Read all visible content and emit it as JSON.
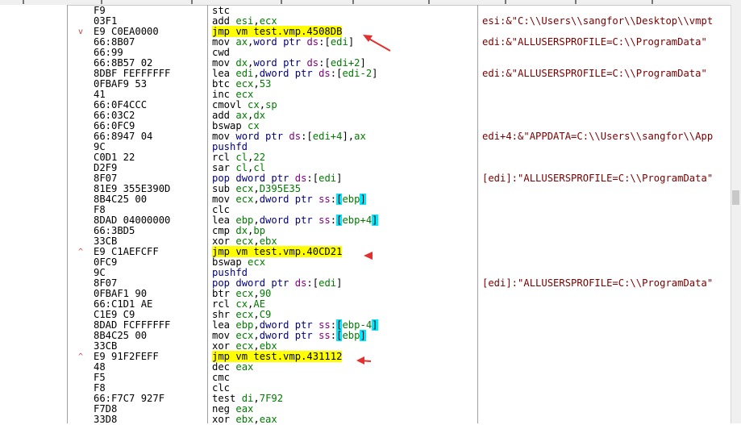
{
  "rows": [
    {
      "bytes": "F9",
      "mn": "stc",
      "ops": [],
      "comment": ""
    },
    {
      "bytes": "03F1",
      "mn": "add",
      "ops": [
        {
          "t": "reg",
          "v": "esi"
        },
        {
          "t": "p",
          "v": ","
        },
        {
          "t": "reg",
          "v": "ecx"
        }
      ],
      "comment": "esi:&\"C:\\\\Users\\\\sangfor\\\\Desktop\\\\vmpt"
    },
    {
      "bytes": "E9 C0EA0000",
      "mn": "jmp",
      "ops": [
        {
          "t": "jt",
          "v": "vm test.vmp.4508DB"
        }
      ],
      "comment": "",
      "jump": true,
      "fold": "v"
    },
    {
      "bytes": "66:8B07",
      "mn": "mov",
      "ops": [
        {
          "t": "reg",
          "v": "ax"
        },
        {
          "t": "p",
          "v": ","
        },
        {
          "t": "kw",
          "v": "word ptr "
        },
        {
          "t": "seg",
          "v": "ds"
        },
        {
          "t": "p",
          "v": ":["
        },
        {
          "t": "reg",
          "v": "edi"
        },
        {
          "t": "p",
          "v": "]"
        }
      ],
      "comment": "edi:&\"ALLUSERSPROFILE=C:\\\\ProgramData\""
    },
    {
      "bytes": "66:99",
      "mn": "cwd",
      "ops": [],
      "comment": ""
    },
    {
      "bytes": "66:8B57 02",
      "mn": "mov",
      "ops": [
        {
          "t": "reg",
          "v": "dx"
        },
        {
          "t": "p",
          "v": ","
        },
        {
          "t": "kw",
          "v": "word ptr "
        },
        {
          "t": "seg",
          "v": "ds"
        },
        {
          "t": "p",
          "v": ":["
        },
        {
          "t": "reg",
          "v": "edi+2"
        },
        {
          "t": "p",
          "v": "]"
        }
      ],
      "comment": ""
    },
    {
      "bytes": "8DBF FEFFFFFF",
      "mn": "lea",
      "ops": [
        {
          "t": "reg",
          "v": "edi"
        },
        {
          "t": "p",
          "v": ","
        },
        {
          "t": "kw",
          "v": "dword ptr "
        },
        {
          "t": "seg",
          "v": "ds"
        },
        {
          "t": "p",
          "v": ":["
        },
        {
          "t": "reg",
          "v": "edi-2"
        },
        {
          "t": "p",
          "v": "]"
        }
      ],
      "comment": "edi:&\"ALLUSERSPROFILE=C:\\\\ProgramData\""
    },
    {
      "bytes": "0FBAF9 53",
      "mn": "btc",
      "ops": [
        {
          "t": "reg",
          "v": "ecx"
        },
        {
          "t": "p",
          "v": ","
        },
        {
          "t": "num",
          "v": "53"
        }
      ],
      "comment": ""
    },
    {
      "bytes": "41",
      "mn": "inc",
      "ops": [
        {
          "t": "reg",
          "v": "ecx"
        }
      ],
      "comment": ""
    },
    {
      "bytes": "66:0F4CCC",
      "mn": "cmovl",
      "ops": [
        {
          "t": "reg",
          "v": "cx"
        },
        {
          "t": "p",
          "v": ","
        },
        {
          "t": "reg",
          "v": "sp"
        }
      ],
      "comment": ""
    },
    {
      "bytes": "66:03C2",
      "mn": "add",
      "ops": [
        {
          "t": "reg",
          "v": "ax"
        },
        {
          "t": "p",
          "v": ","
        },
        {
          "t": "reg",
          "v": "dx"
        }
      ],
      "comment": ""
    },
    {
      "bytes": "66:0FC9",
      "mn": "bswap",
      "ops": [
        {
          "t": "reg",
          "v": "cx"
        }
      ],
      "comment": ""
    },
    {
      "bytes": "66:8947 04",
      "mn": "mov",
      "ops": [
        {
          "t": "kw",
          "v": "word ptr "
        },
        {
          "t": "seg",
          "v": "ds"
        },
        {
          "t": "p",
          "v": ":["
        },
        {
          "t": "reg",
          "v": "edi+4"
        },
        {
          "t": "p",
          "v": "],"
        },
        {
          "t": "reg",
          "v": "ax"
        }
      ],
      "comment": "edi+4:&\"APPDATA=C:\\\\Users\\\\sangfor\\\\App"
    },
    {
      "bytes": "9C",
      "mn": "pushfd",
      "ops": [],
      "comment": "",
      "mnc": "op"
    },
    {
      "bytes": "C0D1 22",
      "mn": "rcl",
      "ops": [
        {
          "t": "reg",
          "v": "cl"
        },
        {
          "t": "p",
          "v": ","
        },
        {
          "t": "num",
          "v": "22"
        }
      ],
      "comment": ""
    },
    {
      "bytes": "D2F9",
      "mn": "sar",
      "ops": [
        {
          "t": "reg",
          "v": "cl"
        },
        {
          "t": "p",
          "v": ","
        },
        {
          "t": "reg",
          "v": "cl"
        }
      ],
      "comment": ""
    },
    {
      "bytes": "8F07",
      "mn": "pop",
      "ops": [
        {
          "t": "kw",
          "v": "dword ptr "
        },
        {
          "t": "seg",
          "v": "ds"
        },
        {
          "t": "p",
          "v": ":["
        },
        {
          "t": "reg",
          "v": "edi"
        },
        {
          "t": "p",
          "v": "]"
        }
      ],
      "comment": "[edi]:\"ALLUSERSPROFILE=C:\\\\ProgramData\"",
      "mnc": "op"
    },
    {
      "bytes": "81E9 355E390D",
      "mn": "sub",
      "ops": [
        {
          "t": "reg",
          "v": "ecx"
        },
        {
          "t": "p",
          "v": ","
        },
        {
          "t": "num",
          "v": "D395E35"
        }
      ],
      "comment": ""
    },
    {
      "bytes": "8B4C25 00",
      "mn": "mov",
      "ops": [
        {
          "t": "reg",
          "v": "ecx"
        },
        {
          "t": "p",
          "v": ","
        },
        {
          "t": "kw",
          "v": "dword ptr "
        },
        {
          "t": "seg",
          "v": "ss"
        },
        {
          "t": "p",
          "v": ":"
        },
        {
          "t": "cy",
          "v": "["
        },
        {
          "t": "reg",
          "v": "ebp"
        },
        {
          "t": "cy",
          "v": "]"
        }
      ],
      "comment": ""
    },
    {
      "bytes": "F8",
      "mn": "clc",
      "ops": [],
      "comment": ""
    },
    {
      "bytes": "8DAD 04000000",
      "mn": "lea",
      "ops": [
        {
          "t": "reg",
          "v": "ebp"
        },
        {
          "t": "p",
          "v": ","
        },
        {
          "t": "kw",
          "v": "dword ptr "
        },
        {
          "t": "seg",
          "v": "ss"
        },
        {
          "t": "p",
          "v": ":"
        },
        {
          "t": "cy",
          "v": "["
        },
        {
          "t": "reg",
          "v": "ebp+4"
        },
        {
          "t": "cy",
          "v": "]"
        }
      ],
      "comment": ""
    },
    {
      "bytes": "66:3BD5",
      "mn": "cmp",
      "ops": [
        {
          "t": "reg",
          "v": "dx"
        },
        {
          "t": "p",
          "v": ","
        },
        {
          "t": "reg",
          "v": "bp"
        }
      ],
      "comment": ""
    },
    {
      "bytes": "33CB",
      "mn": "xor",
      "ops": [
        {
          "t": "reg",
          "v": "ecx"
        },
        {
          "t": "p",
          "v": ","
        },
        {
          "t": "reg",
          "v": "ebx"
        }
      ],
      "comment": ""
    },
    {
      "bytes": "E9 C1AEFCFF",
      "mn": "jmp",
      "ops": [
        {
          "t": "jt",
          "v": "vm test.vmp.40CD21"
        }
      ],
      "comment": "",
      "jump": true,
      "fold": "^"
    },
    {
      "bytes": "0FC9",
      "mn": "bswap",
      "ops": [
        {
          "t": "reg",
          "v": "ecx"
        }
      ],
      "comment": ""
    },
    {
      "bytes": "9C",
      "mn": "pushfd",
      "ops": [],
      "comment": "",
      "mnc": "op"
    },
    {
      "bytes": "8F07",
      "mn": "pop",
      "ops": [
        {
          "t": "kw",
          "v": "dword ptr "
        },
        {
          "t": "seg",
          "v": "ds"
        },
        {
          "t": "p",
          "v": ":["
        },
        {
          "t": "reg",
          "v": "edi"
        },
        {
          "t": "p",
          "v": "]"
        }
      ],
      "comment": "[edi]:\"ALLUSERSPROFILE=C:\\\\ProgramData\"",
      "mnc": "op"
    },
    {
      "bytes": "0FBAF1 90",
      "mn": "btr",
      "ops": [
        {
          "t": "reg",
          "v": "ecx"
        },
        {
          "t": "p",
          "v": ","
        },
        {
          "t": "num",
          "v": "90"
        }
      ],
      "comment": ""
    },
    {
      "bytes": "66:C1D1 AE",
      "mn": "rcl",
      "ops": [
        {
          "t": "reg",
          "v": "cx"
        },
        {
          "t": "p",
          "v": ","
        },
        {
          "t": "num",
          "v": "AE"
        }
      ],
      "comment": ""
    },
    {
      "bytes": "C1E9 C9",
      "mn": "shr",
      "ops": [
        {
          "t": "reg",
          "v": "ecx"
        },
        {
          "t": "p",
          "v": ","
        },
        {
          "t": "num",
          "v": "C9"
        }
      ],
      "comment": ""
    },
    {
      "bytes": "8DAD FCFFFFFF",
      "mn": "lea",
      "ops": [
        {
          "t": "reg",
          "v": "ebp"
        },
        {
          "t": "p",
          "v": ","
        },
        {
          "t": "kw",
          "v": "dword ptr "
        },
        {
          "t": "seg",
          "v": "ss"
        },
        {
          "t": "p",
          "v": ":"
        },
        {
          "t": "cy",
          "v": "["
        },
        {
          "t": "reg",
          "v": "ebp-4"
        },
        {
          "t": "cy",
          "v": "]"
        }
      ],
      "comment": ""
    },
    {
      "bytes": "8B4C25 00",
      "mn": "mov",
      "ops": [
        {
          "t": "reg",
          "v": "ecx"
        },
        {
          "t": "p",
          "v": ","
        },
        {
          "t": "kw",
          "v": "dword ptr "
        },
        {
          "t": "seg",
          "v": "ss"
        },
        {
          "t": "p",
          "v": ":"
        },
        {
          "t": "cy",
          "v": "["
        },
        {
          "t": "reg",
          "v": "ebp"
        },
        {
          "t": "cy",
          "v": "]"
        }
      ],
      "comment": ""
    },
    {
      "bytes": "33CB",
      "mn": "xor",
      "ops": [
        {
          "t": "reg",
          "v": "ecx"
        },
        {
          "t": "p",
          "v": ","
        },
        {
          "t": "reg",
          "v": "ebx"
        }
      ],
      "comment": ""
    },
    {
      "bytes": "E9 91F2FEFF",
      "mn": "jmp",
      "ops": [
        {
          "t": "jt",
          "v": "vm test.vmp.431112"
        }
      ],
      "comment": "",
      "jump": true,
      "fold": "^"
    },
    {
      "bytes": "48",
      "mn": "dec",
      "ops": [
        {
          "t": "reg",
          "v": "eax"
        }
      ],
      "comment": ""
    },
    {
      "bytes": "F5",
      "mn": "cmc",
      "ops": [],
      "comment": ""
    },
    {
      "bytes": "F8",
      "mn": "clc",
      "ops": [],
      "comment": ""
    },
    {
      "bytes": "66:F7C7 927F",
      "mn": "test",
      "ops": [
        {
          "t": "reg",
          "v": "di"
        },
        {
          "t": "p",
          "v": ","
        },
        {
          "t": "num",
          "v": "7F92"
        }
      ],
      "comment": ""
    },
    {
      "bytes": "F7D8",
      "mn": "neg",
      "ops": [
        {
          "t": "reg",
          "v": "eax"
        }
      ],
      "comment": ""
    },
    {
      "bytes": "33D8",
      "mn": "xor",
      "ops": [
        {
          "t": "reg",
          "v": "ebx"
        },
        {
          "t": "p",
          "v": ","
        },
        {
          "t": "reg",
          "v": "eax"
        }
      ],
      "comment": ""
    }
  ],
  "colors": {
    "highlight": "#ffff00",
    "register": "#007a00",
    "keyword": "#000080",
    "segment": "#800080",
    "bracket": "#00e8ff",
    "comment": "#7a0000",
    "annotation_arrow": "#e03030"
  },
  "icons": {
    "fold_down": "chevron-down-icon",
    "fold_up": "chevron-up-icon",
    "annotation": "red-arrow-icon"
  }
}
